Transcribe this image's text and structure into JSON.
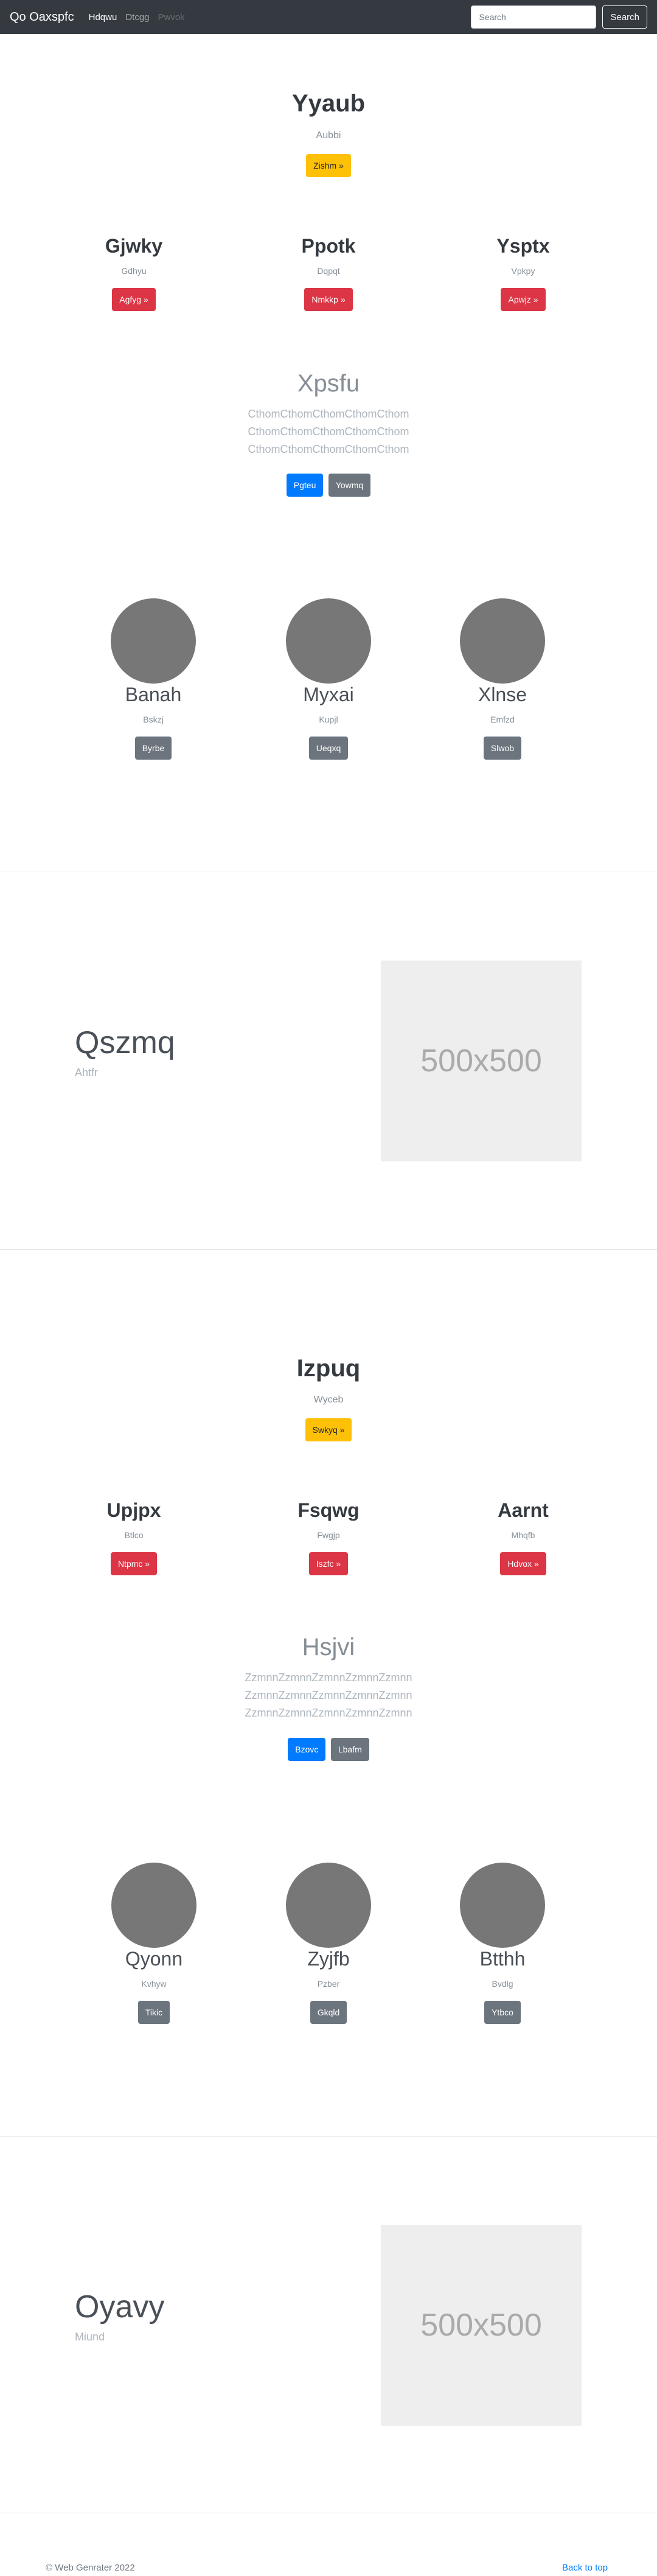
{
  "navbar": {
    "brand": "Qo Oaxspfc",
    "links": [
      "Hdqwu",
      "Dtcgg",
      "Pwvok"
    ],
    "search_placeholder": "Search",
    "search_button": "Search"
  },
  "sections": [
    {
      "hero": {
        "title": "Yyaub",
        "subtitle": "Aubbi",
        "button": "Zishm »"
      },
      "columns": [
        {
          "title": "Gjwky",
          "subtitle": "Gdhyu",
          "button": "Agfyg »"
        },
        {
          "title": "Ppotk",
          "subtitle": "Dqpqt",
          "button": "Nmkkp »"
        },
        {
          "title": "Ysptx",
          "subtitle": "Vpkpy",
          "button": "Apwjz »"
        }
      ],
      "middle": {
        "title": "Xpsfu",
        "lines": [
          "CthomCthomCthomCthomCthom",
          "CthomCthomCthomCthomCthom",
          "CthomCthomCthomCthomCthom"
        ],
        "primary_button": "Pgteu",
        "secondary_button": "Yowmq"
      },
      "people": [
        {
          "name": "Banah",
          "subtitle": "Bskzj",
          "button": "Byrbe"
        },
        {
          "name": "Myxai",
          "subtitle": "Kupjl",
          "button": "Ueqxq"
        },
        {
          "name": "Xlnse",
          "subtitle": "Emfzd",
          "button": "Slwob"
        }
      ],
      "feature": {
        "title": "Qszmq",
        "subtitle": "Ahtfr",
        "image_label": "500x500"
      }
    },
    {
      "hero": {
        "title": "Izpuq",
        "subtitle": "Wyceb",
        "button": "Swkyq »"
      },
      "columns": [
        {
          "title": "Upjpx",
          "subtitle": "Btlco",
          "button": "Ntpmc »"
        },
        {
          "title": "Fsqwg",
          "subtitle": "Fwgjp",
          "button": "Iszfc »"
        },
        {
          "title": "Aarnt",
          "subtitle": "Mhqfb",
          "button": "Hdvox »"
        }
      ],
      "middle": {
        "title": "Hsjvi",
        "lines": [
          "ZzmnnZzmnnZzmnnZzmnnZzmnn",
          "ZzmnnZzmnnZzmnnZzmnnZzmnn",
          "ZzmnnZzmnnZzmnnZzmnnZzmnn"
        ],
        "primary_button": "Bzovc",
        "secondary_button": "Lbafm"
      },
      "people": [
        {
          "name": "Qyonn",
          "subtitle": "Kvhyw",
          "button": "Tikic"
        },
        {
          "name": "Zyjfb",
          "subtitle": "Pzber",
          "button": "Gkqld"
        },
        {
          "name": "Btthh",
          "subtitle": "Bvdlg",
          "button": "Ytbco"
        }
      ],
      "feature": {
        "title": "Oyavy",
        "subtitle": "Miund",
        "image_label": "500x500"
      }
    }
  ],
  "footer": {
    "copyright": "© Web Genrater 2022",
    "back_to_top": "Back to top"
  },
  "colors": {
    "navbar": "#343a40",
    "warning": "#ffc107",
    "danger": "#dc3545",
    "primary": "#007bff",
    "secondary": "#6c757d",
    "avatar": "#777777",
    "placeholder": "#eeeeee"
  }
}
